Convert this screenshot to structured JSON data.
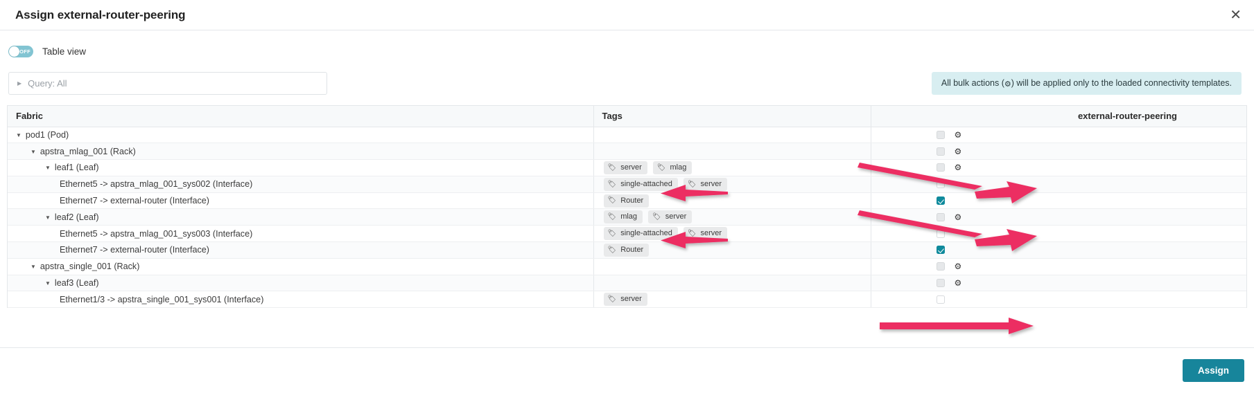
{
  "header": {
    "title": "Assign external-router-peering",
    "close_icon": "close-icon"
  },
  "toggle": {
    "state_label": "OFF",
    "label": "Table view",
    "checked": false
  },
  "query": {
    "caret_icon": "chevron-right-icon",
    "text": "Query: All"
  },
  "notice": {
    "prefix": "All bulk actions (",
    "gear_icon": "gear-icon",
    "suffix": ") will be applied only to the loaded connectivity templates."
  },
  "table": {
    "columns": {
      "fabric": "Fabric",
      "tags": "Tags",
      "ct": "external-router-peering"
    },
    "rows": [
      {
        "label": "pod1 (Pod)",
        "indent": 1,
        "caret": true,
        "tags": [],
        "checkbox": "unchecked",
        "gear": true,
        "alt": false
      },
      {
        "label": "apstra_mlag_001 (Rack)",
        "indent": 2,
        "caret": true,
        "tags": [],
        "checkbox": "unchecked",
        "gear": true,
        "alt": true
      },
      {
        "label": "leaf1 (Leaf)",
        "indent": 3,
        "caret": true,
        "tags": [
          "server",
          "mlag"
        ],
        "checkbox": "unchecked",
        "gear": true,
        "alt": false
      },
      {
        "label": "Ethernet5 -> apstra_mlag_001_sys002 (Interface)",
        "indent": 4,
        "caret": false,
        "tags": [
          "single-attached",
          "server"
        ],
        "checkbox": "empty",
        "gear": false,
        "alt": true
      },
      {
        "label": "Ethernet7 -> external-router (Interface)",
        "indent": 4,
        "caret": false,
        "tags": [
          "Router"
        ],
        "checkbox": "checked",
        "gear": false,
        "alt": false
      },
      {
        "label": "leaf2 (Leaf)",
        "indent": 3,
        "caret": true,
        "tags": [
          "mlag",
          "server"
        ],
        "checkbox": "unchecked",
        "gear": true,
        "alt": true
      },
      {
        "label": "Ethernet5 -> apstra_mlag_001_sys003 (Interface)",
        "indent": 4,
        "caret": false,
        "tags": [
          "single-attached",
          "server"
        ],
        "checkbox": "empty",
        "gear": false,
        "alt": false
      },
      {
        "label": "Ethernet7 -> external-router (Interface)",
        "indent": 4,
        "caret": false,
        "tags": [
          "Router"
        ],
        "checkbox": "checked",
        "gear": false,
        "alt": true
      },
      {
        "label": "apstra_single_001 (Rack)",
        "indent": 2,
        "caret": true,
        "tags": [],
        "checkbox": "unchecked",
        "gear": true,
        "alt": false
      },
      {
        "label": "leaf3 (Leaf)",
        "indent": 3,
        "caret": true,
        "tags": [],
        "checkbox": "unchecked",
        "gear": true,
        "alt": true
      },
      {
        "label": "Ethernet1/3 -> apstra_single_001_sys001 (Interface)",
        "indent": 4,
        "caret": false,
        "tags": [
          "server"
        ],
        "checkbox": "empty",
        "gear": false,
        "alt": false
      }
    ]
  },
  "footer": {
    "assign_label": "Assign"
  },
  "colors": {
    "accent": "#17859b",
    "checkbox_checked": "#0f8a9c",
    "toggle_on": "#82c4d2",
    "notice_bg": "#d8eef1",
    "arrow": "#ec2f62"
  },
  "annotations": [
    {
      "name": "arrow-to-router-tag-leaf1"
    },
    {
      "name": "arrow-to-checkbox-leaf1"
    },
    {
      "name": "arrow-to-router-tag-leaf2"
    },
    {
      "name": "arrow-to-checkbox-leaf2"
    },
    {
      "name": "arrow-to-assign-button"
    }
  ]
}
